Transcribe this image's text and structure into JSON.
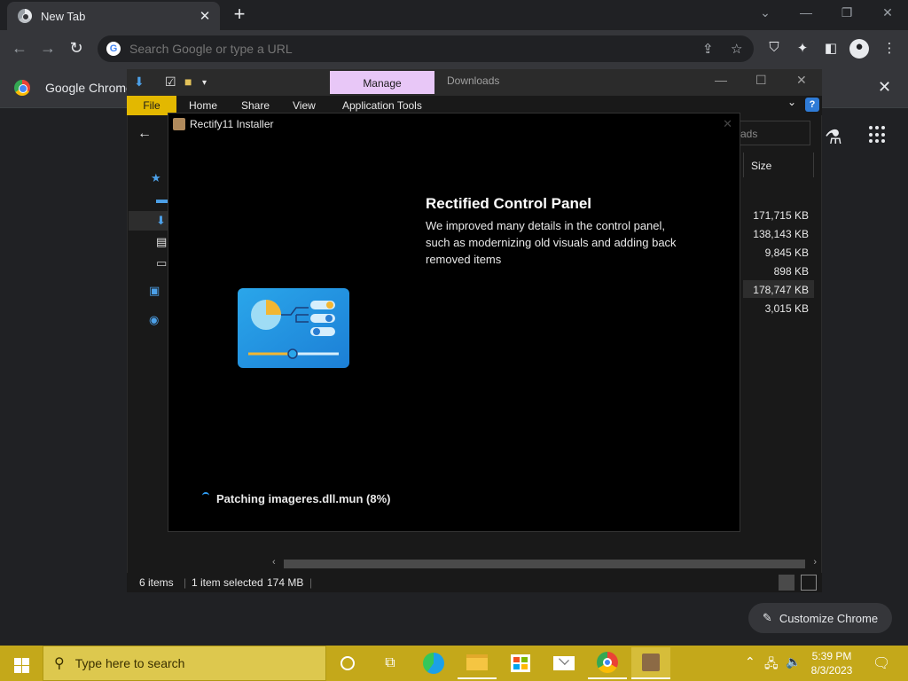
{
  "chrome": {
    "tab_title": "New Tab",
    "tab_close": "✕",
    "new_tab": "+",
    "omnibox_placeholder": "Search Google or type a URL",
    "bookmark_label": "Google Chrome",
    "customize_label": "Customize Chrome"
  },
  "explorer": {
    "manage_tab": "Manage",
    "window_title": "Downloads",
    "ribbon": {
      "file": "File",
      "home": "Home",
      "share": "Share",
      "view": "View",
      "app_tools": "Application Tools"
    },
    "search_partial": "ads",
    "size_header": "Size",
    "sizes": [
      "171,715 KB",
      "138,143 KB",
      "9,845 KB",
      "898 KB",
      "178,747 KB",
      "3,015 KB"
    ],
    "status": {
      "items": "6 items",
      "selected": "1 item selected",
      "size": "174 MB"
    }
  },
  "installer": {
    "title": "Rectify11 Installer",
    "feature_title": "Rectified Control Panel",
    "feature_desc": "We improved many details in the control panel, such as modernizing old visuals and adding back removed items",
    "progress_text": "Patching imageres.dll.mun (8%)",
    "progress_percent": 8
  },
  "taskbar": {
    "search_placeholder": "Type here to search",
    "time": "5:39 PM",
    "date": "8/3/2023"
  },
  "colors": {
    "taskbar": "#c4a81a",
    "manage_tab": "#e8c7f7",
    "file_tab": "#e3b800",
    "accent_blue": "#2f9df4"
  }
}
